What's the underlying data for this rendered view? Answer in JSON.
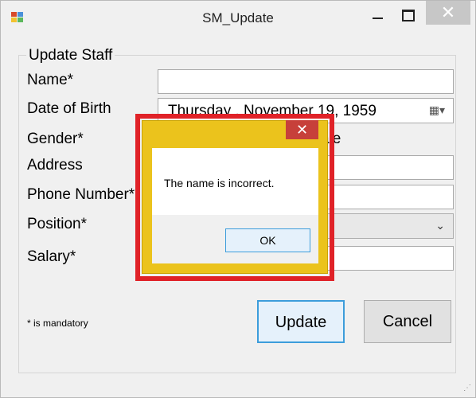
{
  "window": {
    "title": "SM_Update",
    "close_glyph": "✕",
    "app_icon": "app-icon"
  },
  "form": {
    "group_title": "Update Staff",
    "labels": {
      "name": "Name*",
      "dob": "Date of Birth",
      "gender": "Gender*",
      "address": "Address",
      "phone": "Phone Number*",
      "position": "Position*",
      "salary": "Salary*"
    },
    "values": {
      "name": "",
      "dob": "Thursday  ,  November  19, 1959",
      "gender_visible_fragment": "ale",
      "address": "",
      "phone": "",
      "position": "",
      "salary": ""
    },
    "mandatory_note": "* is mandatory",
    "buttons": {
      "update": "Update",
      "cancel": "Cancel"
    }
  },
  "dialog": {
    "message": "The name is incorrect.",
    "ok_label": "OK",
    "close_glyph": "✕",
    "highlight_color": "#e02228",
    "frame_color": "#ebc31c"
  }
}
